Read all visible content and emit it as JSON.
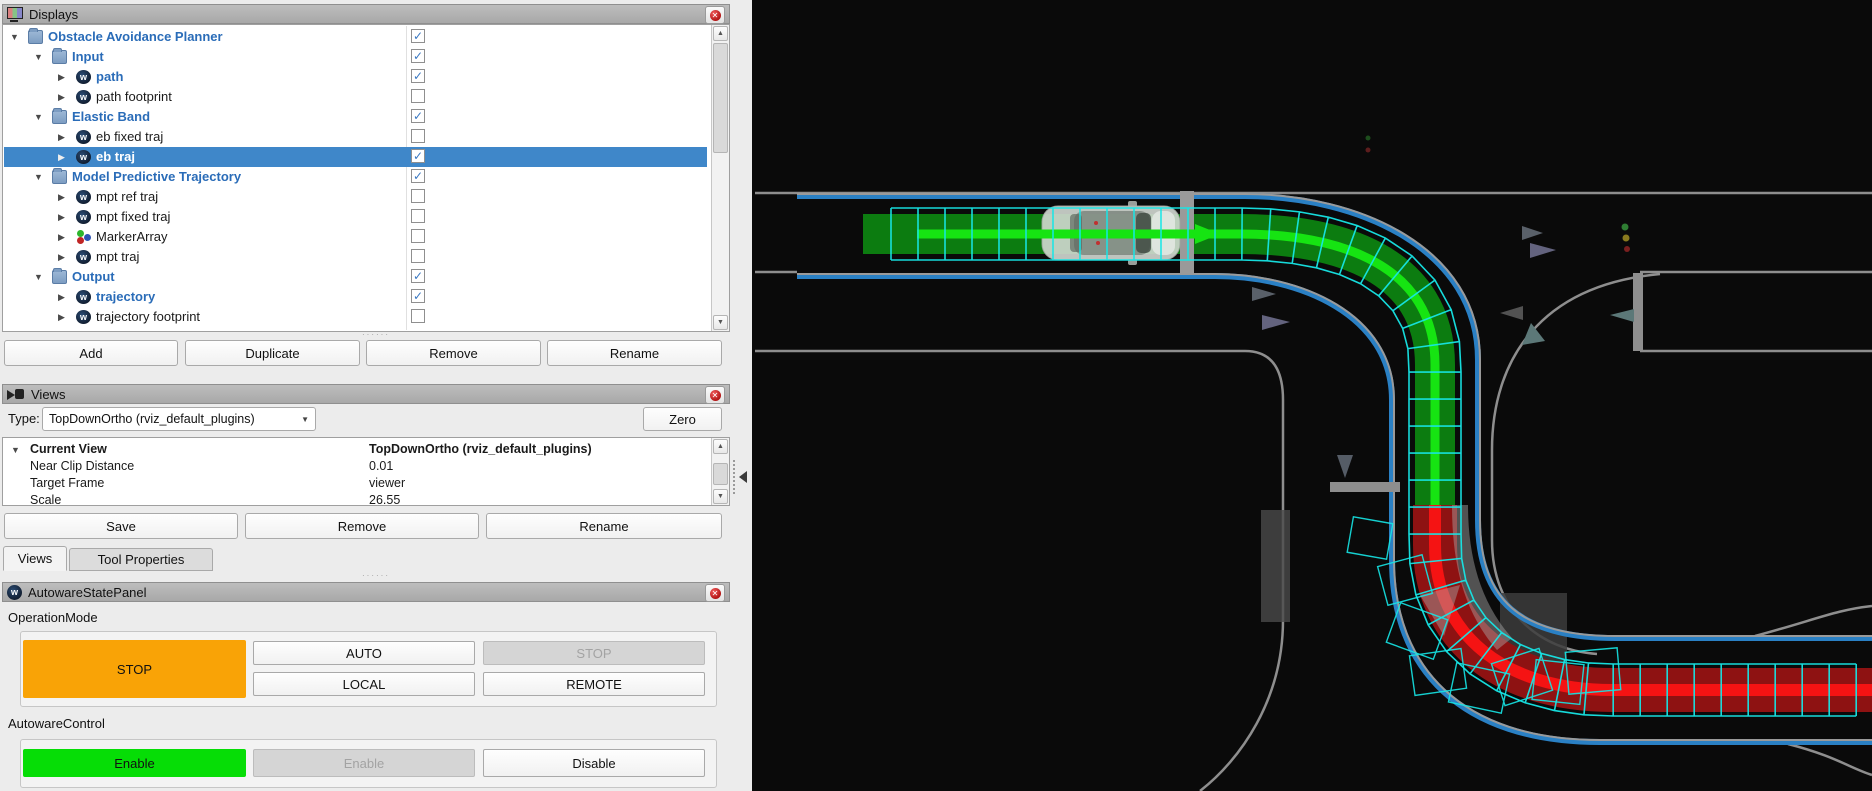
{
  "displays": {
    "title": "Displays",
    "buttons": [
      "Add",
      "Duplicate",
      "Remove",
      "Rename"
    ],
    "tree": [
      {
        "label": "Obstacle Avoidance Planner",
        "level": 0,
        "icon": "folder",
        "emphasis": true,
        "checked": true,
        "expanded": true,
        "selected": false
      },
      {
        "label": "Input",
        "level": 1,
        "icon": "folder",
        "emphasis": true,
        "checked": true,
        "expanded": true,
        "selected": false
      },
      {
        "label": "path",
        "level": 2,
        "icon": "autoware",
        "emphasis": true,
        "checked": true,
        "expanded": false,
        "selected": false
      },
      {
        "label": "path footprint",
        "level": 2,
        "icon": "autoware",
        "emphasis": false,
        "checked": false,
        "expanded": false,
        "selected": false
      },
      {
        "label": "Elastic Band",
        "level": 1,
        "icon": "folder",
        "emphasis": true,
        "checked": true,
        "expanded": true,
        "selected": false
      },
      {
        "label": "eb fixed traj",
        "level": 2,
        "icon": "autoware",
        "emphasis": false,
        "checked": false,
        "expanded": false,
        "selected": false
      },
      {
        "label": "eb traj",
        "level": 2,
        "icon": "autoware",
        "emphasis": false,
        "checked": true,
        "expanded": false,
        "selected": true
      },
      {
        "label": "Model Predictive Trajectory",
        "level": 1,
        "icon": "folder",
        "emphasis": true,
        "checked": true,
        "expanded": true,
        "selected": false
      },
      {
        "label": "mpt ref traj",
        "level": 2,
        "icon": "autoware",
        "emphasis": false,
        "checked": false,
        "expanded": false,
        "selected": false
      },
      {
        "label": "mpt fixed traj",
        "level": 2,
        "icon": "autoware",
        "emphasis": false,
        "checked": false,
        "expanded": false,
        "selected": false
      },
      {
        "label": "MarkerArray",
        "level": 2,
        "icon": "marker-array",
        "emphasis": false,
        "checked": false,
        "expanded": false,
        "selected": false
      },
      {
        "label": "mpt traj",
        "level": 2,
        "icon": "autoware",
        "emphasis": false,
        "checked": false,
        "expanded": false,
        "selected": false
      },
      {
        "label": "Output",
        "level": 1,
        "icon": "folder",
        "emphasis": true,
        "checked": true,
        "expanded": true,
        "selected": false
      },
      {
        "label": "trajectory",
        "level": 2,
        "icon": "autoware",
        "emphasis": true,
        "checked": true,
        "expanded": false,
        "selected": false
      },
      {
        "label": "trajectory footprint",
        "level": 2,
        "icon": "autoware",
        "emphasis": false,
        "checked": false,
        "expanded": false,
        "selected": false
      }
    ]
  },
  "views": {
    "title": "Views",
    "type_label": "Type:",
    "type_value": "TopDownOrtho (rviz_default_plugins)",
    "zero_button": "Zero",
    "properties": [
      {
        "name": "Current View",
        "value": "TopDownOrtho (rviz_default_plugins)",
        "bold": true,
        "arrow": true
      },
      {
        "name": "Near Clip Distance",
        "value": "0.01",
        "bold": false,
        "arrow": false
      },
      {
        "name": "Target Frame",
        "value": "viewer",
        "bold": false,
        "arrow": false
      },
      {
        "name": "Scale",
        "value": "26.55",
        "bold": false,
        "arrow": false
      }
    ],
    "buttons": [
      "Save",
      "Remove",
      "Rename"
    ],
    "tabs": [
      {
        "label": "Views",
        "active": true
      },
      {
        "label": "Tool Properties",
        "active": false
      }
    ]
  },
  "autoware": {
    "title": "AutowareStatePanel",
    "operation_mode": {
      "label": "OperationMode",
      "stop_active": "STOP",
      "auto": "AUTO",
      "stop_disabled": "STOP",
      "local": "LOCAL",
      "remote": "REMOTE"
    },
    "control": {
      "label": "AutowareControl",
      "enable_active": "Enable",
      "enable_disabled": "Enable",
      "disable": "Disable"
    }
  },
  "colors": {
    "accent_orange": "#f9a306",
    "accent_green": "#06dd06",
    "viz_background": "#0a0a0a",
    "path_green_dark": "#0c7c10",
    "path_green_bright": "#16e412",
    "traj_red_dark": "#8e1212",
    "traj_red_bright": "#f51313",
    "lane_blue": "#2a80c4",
    "road_gray": "#969696",
    "footprint_cyan": "#17e6e6"
  }
}
